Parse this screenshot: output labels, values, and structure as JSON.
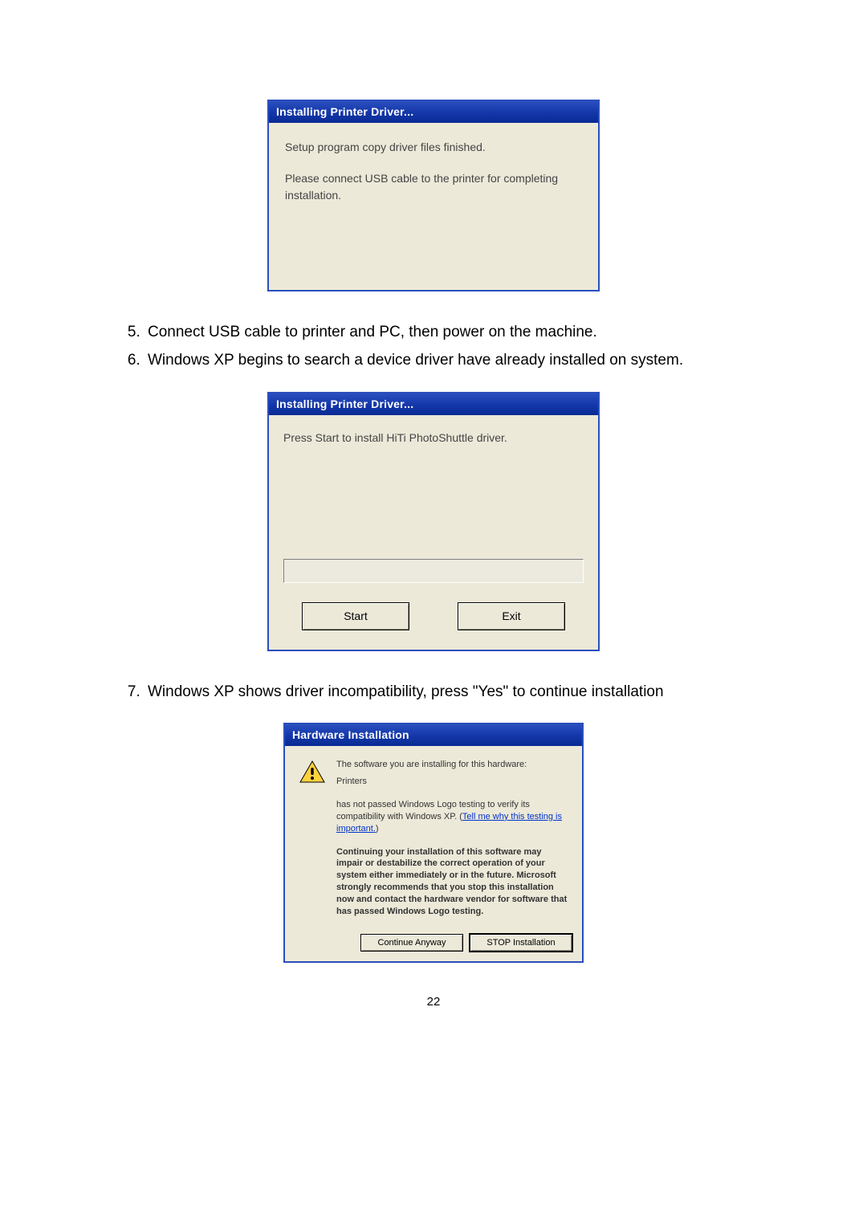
{
  "dialog1": {
    "title": "Installing Printer Driver...",
    "line1": "Setup program copy driver files finished.",
    "line2": "Please connect USB cable to the printer for completing installation."
  },
  "list": {
    "start": 5,
    "item5": "Connect USB cable to printer and PC, then power on the machine.",
    "item6": "Windows XP begins to search a device driver have already installed on system.",
    "item7": "Windows XP shows driver incompatibility, press \"Yes\" to continue installation"
  },
  "dialog2": {
    "title": "Installing Printer Driver...",
    "body": "Press Start to install HiTi PhotoShuttle driver.",
    "start": "Start",
    "exit": "Exit"
  },
  "dialog3": {
    "title": "Hardware Installation",
    "l1": "The software you are installing for this hardware:",
    "l2": "Printers",
    "l3a": "has not passed Windows Logo testing to verify its compatibility with Windows XP. (",
    "link": "Tell me why this testing is important.",
    "l3b": ")",
    "bold": "Continuing your installation of this software may impair or destabilize the correct operation of your system either immediately or in the future. Microsoft strongly recommends that you stop this installation now and contact the hardware vendor for software that has passed Windows Logo testing.",
    "continue": "Continue Anyway",
    "stop": "STOP Installation"
  },
  "page_num": "22"
}
